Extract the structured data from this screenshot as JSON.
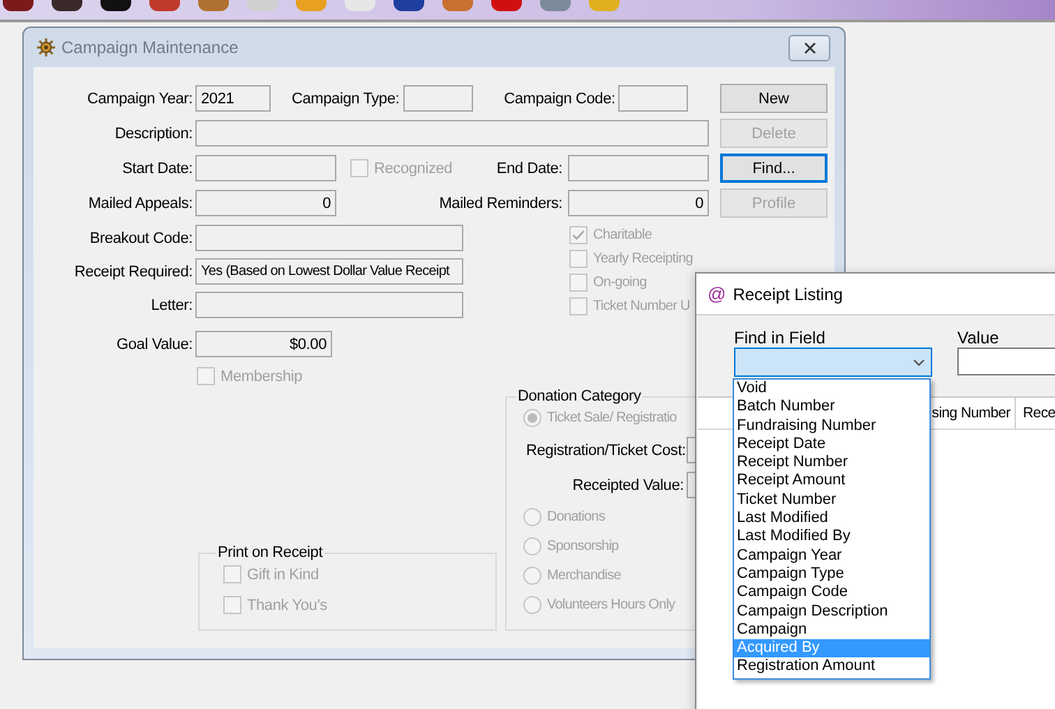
{
  "campaign": {
    "title": "Campaign Maintenance",
    "campaign_year": {
      "label": "Campaign Year:",
      "value": "2021"
    },
    "campaign_type": {
      "label": "Campaign Type:"
    },
    "campaign_code": {
      "label": "Campaign Code:"
    },
    "description": {
      "label": "Description:"
    },
    "start_date": {
      "label": "Start Date:"
    },
    "recognized": {
      "label": "Recognized",
      "checked": false,
      "disabled": true
    },
    "end_date": {
      "label": "End Date:"
    },
    "mailed_appeals": {
      "label": "Mailed Appeals:",
      "value": "0"
    },
    "mailed_reminders": {
      "label": "Mailed Reminders:",
      "value": "0"
    },
    "breakout_code": {
      "label": "Breakout Code:"
    },
    "receipt_required": {
      "label": "Receipt Required:",
      "value": "Yes (Based on Lowest Dollar Value Receipt"
    },
    "letter": {
      "label": "Letter:"
    },
    "goal_value": {
      "label": "Goal Value:",
      "value": "$0.00"
    },
    "membership": {
      "label": "Membership",
      "checked": false,
      "disabled": true
    },
    "options": [
      {
        "label": "Charitable",
        "checked": true,
        "disabled": true
      },
      {
        "label": "Yearly Receipting",
        "checked": false,
        "disabled": true
      },
      {
        "label": "On-going",
        "checked": false,
        "disabled": true
      },
      {
        "label": "Ticket Number U",
        "checked": false,
        "disabled": true
      }
    ],
    "buttons": [
      {
        "label": "New",
        "disabled": false,
        "focused": false
      },
      {
        "label": "Delete",
        "disabled": true,
        "focused": false
      },
      {
        "label": "Find...",
        "disabled": false,
        "focused": true
      },
      {
        "label": "Profile",
        "disabled": true,
        "focused": false
      }
    ],
    "print_on_receipt": {
      "title": "Print on Receipt",
      "options": [
        {
          "label": "Gift in Kind",
          "checked": false,
          "disabled": true
        },
        {
          "label": "Thank You's",
          "checked": false,
          "disabled": true
        }
      ]
    },
    "donation_category": {
      "title": "Donation Category",
      "options": [
        {
          "label": "Ticket Sale/ Registratio",
          "selected": true,
          "disabled": true
        },
        {
          "label": "Donations",
          "selected": false,
          "disabled": true
        },
        {
          "label": "Sponsorship",
          "selected": false,
          "disabled": true
        },
        {
          "label": "Merchandise",
          "selected": false,
          "disabled": true
        },
        {
          "label": "Volunteers Hours Only",
          "selected": false,
          "disabled": true
        }
      ],
      "registration_cost": {
        "label": "Registration/Ticket Cost:"
      },
      "receipted_value": {
        "label": "Receipted Value:"
      }
    }
  },
  "receipt_listing": {
    "icon": "@",
    "title": "Receipt Listing",
    "find_in_field": {
      "label": "Find in Field"
    },
    "value": {
      "label": "Value"
    },
    "columns": [
      "sing Number",
      "Rece"
    ],
    "dropdown": [
      {
        "label": "Void",
        "selected": false
      },
      {
        "label": "Batch Number",
        "selected": false
      },
      {
        "label": "Fundraising Number",
        "selected": false
      },
      {
        "label": "Receipt Date",
        "selected": false
      },
      {
        "label": "Receipt Number",
        "selected": false
      },
      {
        "label": "Receipt Amount",
        "selected": false
      },
      {
        "label": "Ticket Number",
        "selected": false
      },
      {
        "label": "Last Modified",
        "selected": false
      },
      {
        "label": "Last Modified By",
        "selected": false
      },
      {
        "label": "Campaign Year",
        "selected": false
      },
      {
        "label": "Campaign Type",
        "selected": false
      },
      {
        "label": "Campaign Code",
        "selected": false
      },
      {
        "label": "Campaign Description",
        "selected": false
      },
      {
        "label": "Campaign",
        "selected": false
      },
      {
        "label": "Acquired By",
        "selected": true
      },
      {
        "label": "Registration Amount",
        "selected": false
      }
    ]
  }
}
